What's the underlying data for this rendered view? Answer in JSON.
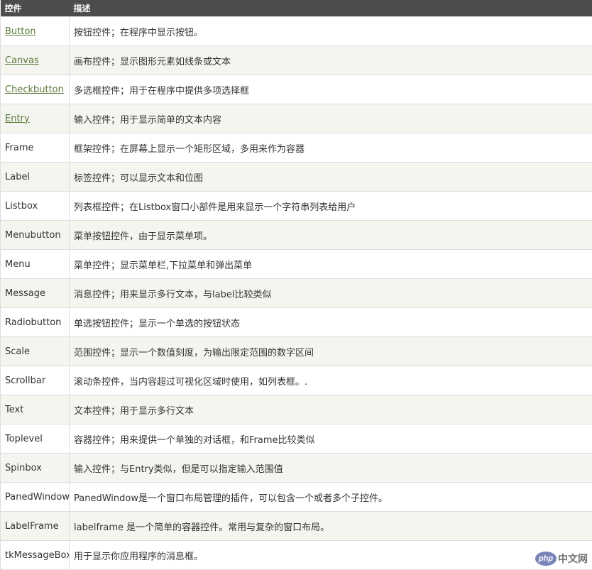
{
  "table": {
    "headers": [
      "控件",
      "描述"
    ],
    "rows": [
      {
        "name": "Button",
        "desc": "按钮控件；在程序中显示按钮。",
        "link": true
      },
      {
        "name": "Canvas",
        "desc": "画布控件；显示图形元素如线条或文本",
        "link": true
      },
      {
        "name": "Checkbutton",
        "desc": "多选框控件；用于在程序中提供多项选择框",
        "link": true
      },
      {
        "name": "Entry",
        "desc": "输入控件；用于显示简单的文本内容",
        "link": true
      },
      {
        "name": "Frame",
        "desc": "框架控件；在屏幕上显示一个矩形区域，多用来作为容器",
        "link": false
      },
      {
        "name": "Label",
        "desc": "标签控件；可以显示文本和位图",
        "link": false
      },
      {
        "name": "Listbox",
        "desc": "列表框控件；在Listbox窗口小部件是用来显示一个字符串列表给用户",
        "link": false
      },
      {
        "name": "Menubutton",
        "desc": "菜单按钮控件，由于显示菜单项。",
        "link": false
      },
      {
        "name": "Menu",
        "desc": "菜单控件；显示菜单栏,下拉菜单和弹出菜单",
        "link": false
      },
      {
        "name": "Message",
        "desc": "消息控件；用来显示多行文本，与label比较类似",
        "link": false
      },
      {
        "name": "Radiobutton",
        "desc": "单选按钮控件；显示一个单选的按钮状态",
        "link": false
      },
      {
        "name": "Scale",
        "desc": "范围控件；显示一个数值刻度，为输出限定范围的数字区间",
        "link": false
      },
      {
        "name": "Scrollbar",
        "desc": "滚动条控件，当内容超过可视化区域时使用，如列表框。.",
        "link": false
      },
      {
        "name": "Text",
        "desc": "文本控件；用于显示多行文本",
        "link": false
      },
      {
        "name": "Toplevel",
        "desc": "容器控件；用来提供一个单独的对话框，和Frame比较类似",
        "link": false
      },
      {
        "name": "Spinbox",
        "desc": "输入控件；与Entry类似，但是可以指定输入范围值",
        "link": false
      },
      {
        "name": "PanedWindow",
        "desc": "PanedWindow是一个窗口布局管理的插件，可以包含一个或者多个子控件。",
        "link": false
      },
      {
        "name": "LabelFrame",
        "desc": "labelframe 是一个简单的容器控件。常用与复杂的窗口布局。",
        "link": false
      },
      {
        "name": "tkMessageBox",
        "desc": "用于显示你应用程序的消息框。",
        "link": false
      }
    ]
  },
  "watermark": {
    "logo": "php",
    "text": "中文网"
  }
}
